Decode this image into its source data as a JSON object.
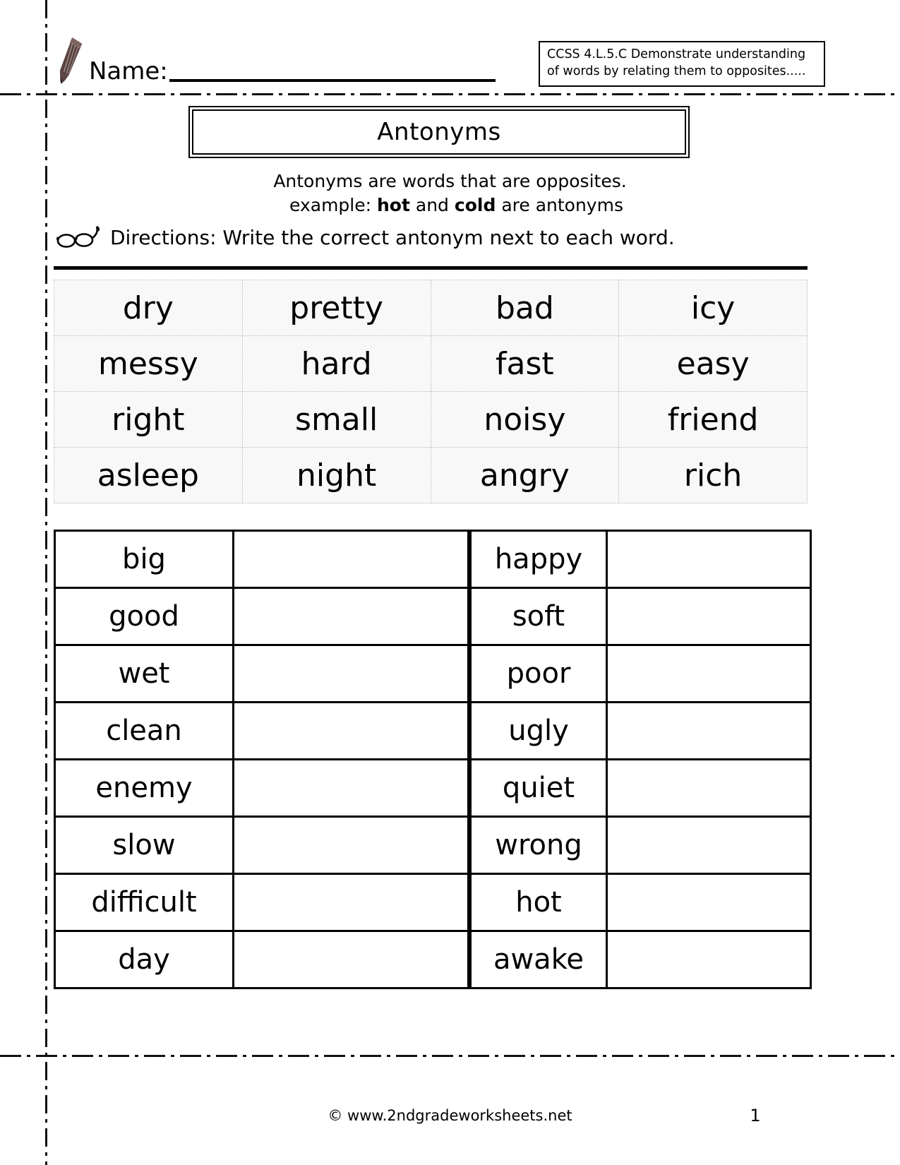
{
  "header": {
    "name_label": "Name:",
    "pencil_icon": "pencil-icon",
    "pencil_color": "#5b4340",
    "standard": {
      "line1": "CCSS 4.L.5.C Demonstrate understanding",
      "line2": "of words by relating them to opposites....."
    }
  },
  "title": "Antonyms",
  "subtitle": {
    "line1": "Antonyms are words that are opposites.",
    "example_prefix": "example:",
    "example_word1": "hot",
    "example_conjunction": "and",
    "example_word2": "cold",
    "example_suffix": "are antonyms"
  },
  "directions": {
    "icon": "glasses-icon",
    "text": "Directions: Write the correct antonym next to each word."
  },
  "word_bank": {
    "rows": [
      [
        "dry",
        "pretty",
        "bad",
        "icy"
      ],
      [
        "messy",
        "hard",
        "fast",
        "easy"
      ],
      [
        "right",
        "small",
        "noisy",
        "friend"
      ],
      [
        "asleep",
        "night",
        "angry",
        "rich"
      ]
    ]
  },
  "answer_table": {
    "rows": [
      {
        "left_word": "big",
        "left_answer": "",
        "right_word": "happy",
        "right_answer": ""
      },
      {
        "left_word": "good",
        "left_answer": "",
        "right_word": "soft",
        "right_answer": ""
      },
      {
        "left_word": "wet",
        "left_answer": "",
        "right_word": "poor",
        "right_answer": ""
      },
      {
        "left_word": "clean",
        "left_answer": "",
        "right_word": "ugly",
        "right_answer": ""
      },
      {
        "left_word": "enemy",
        "left_answer": "",
        "right_word": "quiet",
        "right_answer": ""
      },
      {
        "left_word": "slow",
        "left_answer": "",
        "right_word": "wrong",
        "right_answer": ""
      },
      {
        "left_word": "difficult",
        "left_answer": "",
        "right_word": "hot",
        "right_answer": ""
      },
      {
        "left_word": "day",
        "left_answer": "",
        "right_word": "awake",
        "right_answer": ""
      }
    ]
  },
  "footer": {
    "credit": "© www.2ndgradeworksheets.net",
    "page_number": "1"
  }
}
